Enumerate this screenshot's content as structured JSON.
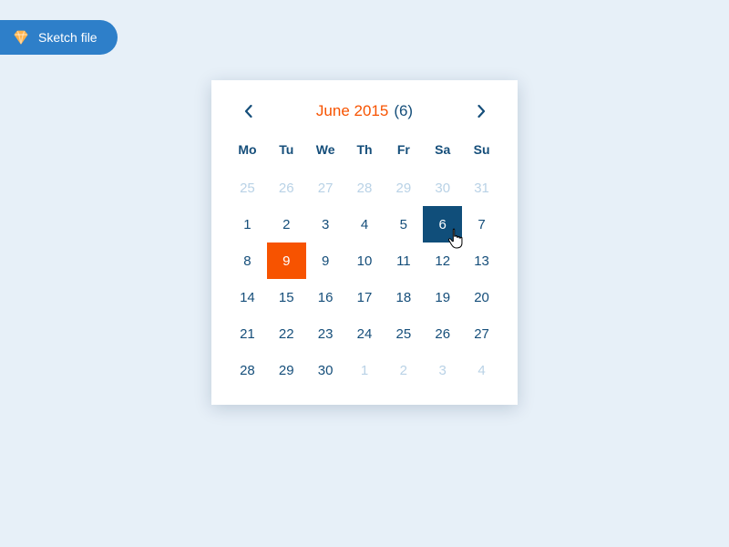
{
  "badge": {
    "label": "Sketch file"
  },
  "calendar": {
    "month_label": "June 2015",
    "selected_count": "(6)",
    "dow": [
      "Mo",
      "Tu",
      "We",
      "Th",
      "Fr",
      "Sa",
      "Su"
    ],
    "days": [
      {
        "n": "25",
        "muted": true
      },
      {
        "n": "26",
        "muted": true
      },
      {
        "n": "27",
        "muted": true
      },
      {
        "n": "28",
        "muted": true
      },
      {
        "n": "29",
        "muted": true
      },
      {
        "n": "30",
        "muted": true
      },
      {
        "n": "31",
        "muted": true
      },
      {
        "n": "1"
      },
      {
        "n": "2"
      },
      {
        "n": "3"
      },
      {
        "n": "4"
      },
      {
        "n": "5"
      },
      {
        "n": "6",
        "sel": "blue",
        "cursor": true
      },
      {
        "n": "7"
      },
      {
        "n": "8"
      },
      {
        "n": "9",
        "sel": "orange"
      },
      {
        "n": "9"
      },
      {
        "n": "10"
      },
      {
        "n": "11"
      },
      {
        "n": "12"
      },
      {
        "n": "13"
      },
      {
        "n": "14"
      },
      {
        "n": "15"
      },
      {
        "n": "16"
      },
      {
        "n": "17"
      },
      {
        "n": "18"
      },
      {
        "n": "19"
      },
      {
        "n": "20"
      },
      {
        "n": "21"
      },
      {
        "n": "22"
      },
      {
        "n": "23"
      },
      {
        "n": "24"
      },
      {
        "n": "25"
      },
      {
        "n": "26"
      },
      {
        "n": "27"
      },
      {
        "n": "28"
      },
      {
        "n": "29"
      },
      {
        "n": "30"
      },
      {
        "n": "1",
        "muted": true
      },
      {
        "n": "2",
        "muted": true
      },
      {
        "n": "3",
        "muted": true
      },
      {
        "n": "4",
        "muted": true
      }
    ]
  },
  "colors": {
    "accent_orange": "#f75300",
    "accent_blue": "#104e7a"
  }
}
